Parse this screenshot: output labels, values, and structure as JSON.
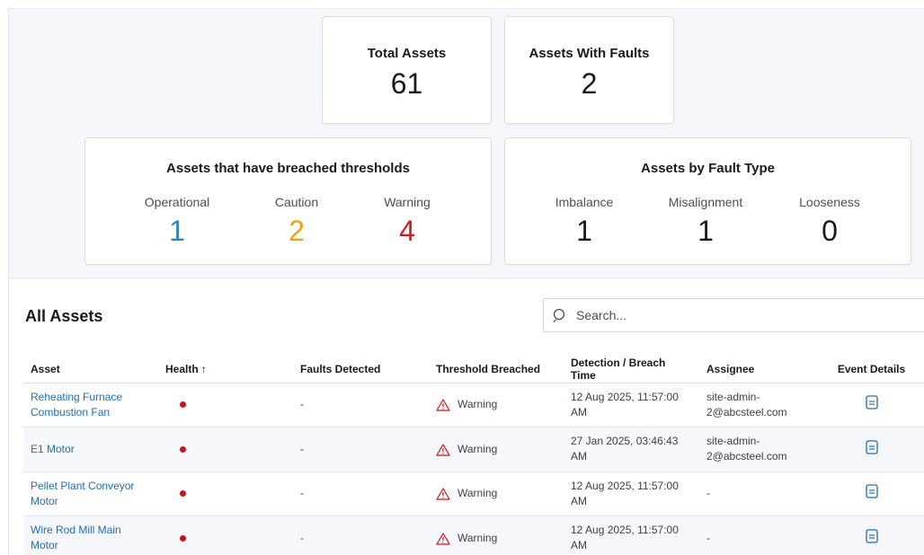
{
  "summary": {
    "total_assets": {
      "label": "Total Assets",
      "value": "61"
    },
    "assets_with_faults": {
      "label": "Assets With Faults",
      "value": "2"
    }
  },
  "breached": {
    "title": "Assets that have breached thresholds",
    "stats": [
      {
        "label": "Operational",
        "value": "1",
        "color": "#2f84b8"
      },
      {
        "label": "Caution",
        "value": "2",
        "color": "#f2a20f"
      },
      {
        "label": "Warning",
        "value": "4",
        "color": "#d7191c"
      }
    ]
  },
  "fault_type": {
    "title": "Assets by Fault Type",
    "stats": [
      {
        "label": "Imbalance",
        "value": "1"
      },
      {
        "label": "Misalignment",
        "value": "1"
      },
      {
        "label": "Looseness",
        "value": "0"
      }
    ]
  },
  "assets": {
    "title": "All Assets",
    "search_placeholder": "Search...",
    "columns": [
      "Asset",
      "Health",
      "Faults Detected",
      "Threshold Breached",
      "Detection / Breach Time",
      "Assignee",
      "Event Details"
    ],
    "sort_arrow": "↑",
    "rows": [
      {
        "asset": "Reheating Furnace Combustion Fan",
        "health": "red",
        "faults": "-",
        "threshold": "Warning",
        "time": "12 Aug 2025, 11:57:00 AM",
        "assignee": "site-admin-2@abcsteel.com"
      },
      {
        "asset": "E1 Motor",
        "health": "red",
        "faults": "-",
        "threshold": "Warning",
        "time": "27 Jan 2025, 03:46:43 AM",
        "assignee": "site-admin-2@abcsteel.com"
      },
      {
        "asset": "Pellet Plant Conveyor Motor",
        "health": "red",
        "faults": "-",
        "threshold": "Warning",
        "time": "12 Aug 2025, 11:57:00 AM",
        "assignee": "-"
      },
      {
        "asset": "Wire Rod Mill Main Motor",
        "health": "red",
        "faults": "-",
        "threshold": "Warning",
        "time": "12 Aug 2025, 11:57:00 AM",
        "assignee": "-"
      }
    ]
  },
  "colors": {
    "accent": "#1f6fb0",
    "danger": "#c3161c",
    "background": "#f5f7fa"
  }
}
